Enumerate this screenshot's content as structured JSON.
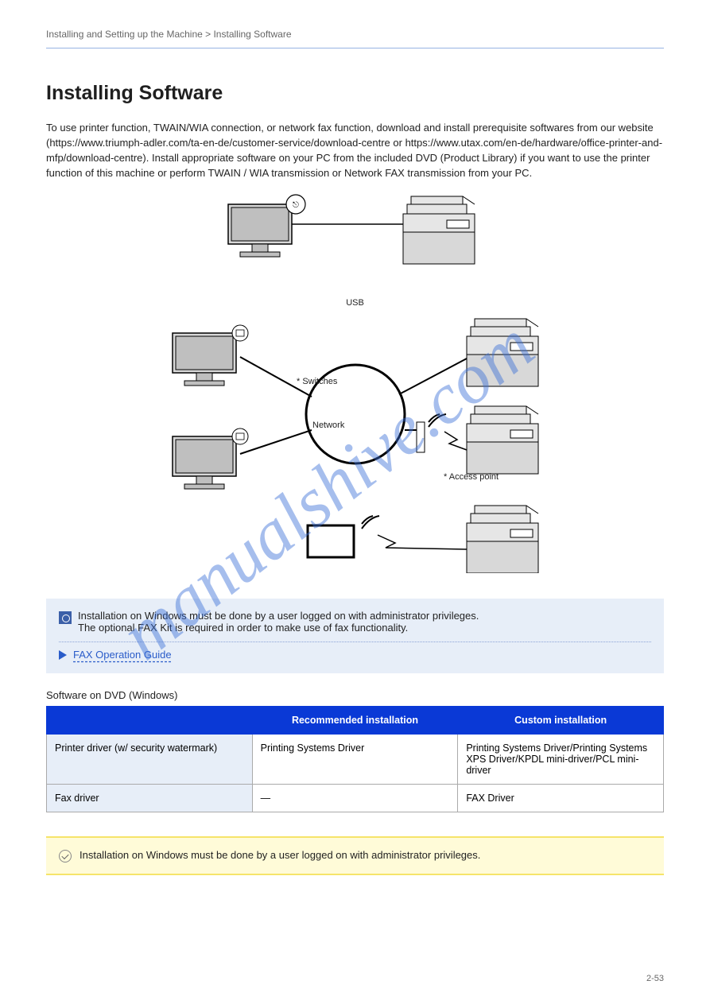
{
  "header": "Installing and Setting up the Machine > Installing Software",
  "title": "Installing Software",
  "intro": "To use printer function, TWAIN/WIA connection, or network fax function, download and install prerequisite softwares from our website (https://www.triumph-adler.com/ta-en-de/customer-service/download-centre or https://www.utax.com/en-de/hardware/office-printer-and-mfp/download-centre). Install appropriate software on your PC from the included DVD (Product Library) if you want to use the printer function of this machine or perform TWAIN / WIA transmission or Network FAX transmission from your PC.",
  "diagram": {
    "usb": "USB",
    "network": "Network",
    "switches": "* Switches",
    "accesspoint": "* Access point",
    "empty": ""
  },
  "note": {
    "line1": "Installation on Windows must be done by a user logged on with administrator privileges.",
    "line2": "The optional FAX Kit is required in order to make use of fax functionality.",
    "link": "FAX Operation Guide"
  },
  "software_caption": "Software on DVD (Windows)",
  "table": {
    "h_blank": "",
    "h_rec": "Recommended installation",
    "h_custom": "Custom installation",
    "row1_label": "Printer driver (w/ security watermark)",
    "row1_rec": "Printing Systems Driver",
    "row1_custom": "Printing Systems Driver/Printing Systems XPS Driver/KPDL mini-driver/PCL mini-driver",
    "row2_label": "Fax driver",
    "row2_rec": "—",
    "row2_custom": "FAX Driver"
  },
  "info": "Installation on Windows must be done by a user logged on with administrator privileges.",
  "footer": {
    "left": "",
    "right": "2-53"
  },
  "watermark": "manualshive.com"
}
